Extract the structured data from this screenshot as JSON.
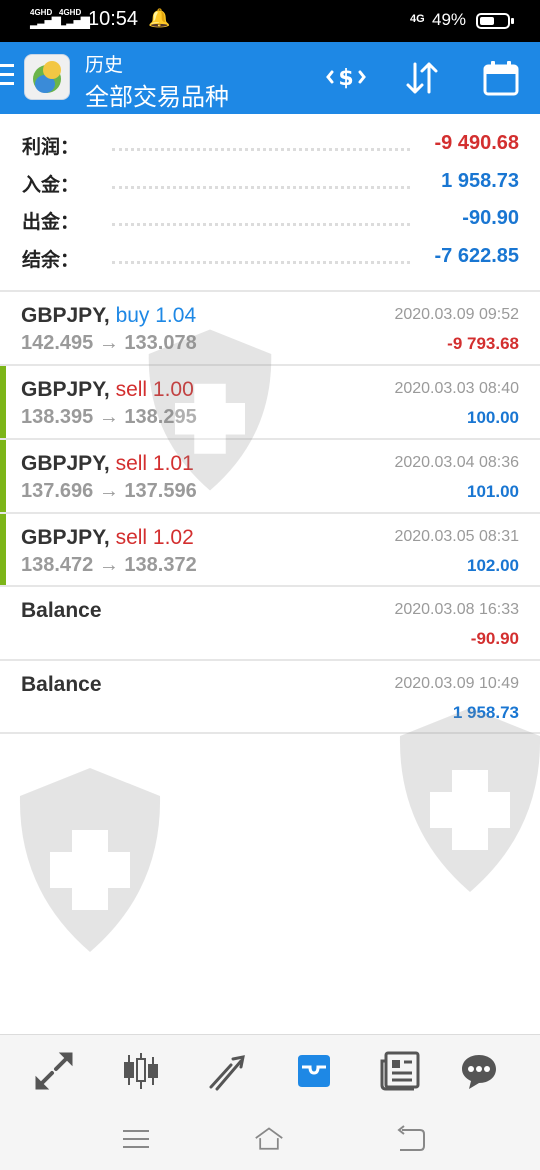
{
  "status_bar": {
    "sig1": "4GHD",
    "sig2": "4GHD",
    "time": "10:54",
    "network": "4G",
    "battery_pct": "49%",
    "battery_level": 0.49
  },
  "header": {
    "subtitle": "历史",
    "title": "全部交易品种",
    "icons": [
      "menu-icon",
      "metatrader-logo",
      "currency-exchange-icon",
      "sort-icon",
      "calendar-icon"
    ]
  },
  "summary": [
    {
      "label": "利润：",
      "value": "-9 490.68",
      "color": "#d32f2f"
    },
    {
      "label": "入金：",
      "value": "1 958.73",
      "color": "#1976d2"
    },
    {
      "label": "出金：",
      "value": "-90.90",
      "color": "#1976d2"
    },
    {
      "label": "结余：",
      "value": "-7 622.85",
      "color": "#1976d2"
    }
  ],
  "trades": [
    {
      "symbol": "GBPJPY,",
      "side": "buy 1.04",
      "side_color": "#1e88e5",
      "prices": "142.495 → 133.078",
      "date": "2020.03.09 09:52",
      "amount": "-9 793.68",
      "amount_color": "#d32f2f",
      "marker": false
    },
    {
      "symbol": "GBPJPY,",
      "side": "sell 1.00",
      "side_color": "#d32f2f",
      "prices": "138.395 → 138.295",
      "date": "2020.03.03 08:40",
      "amount": "100.00",
      "amount_color": "#1976d2",
      "marker": true
    },
    {
      "symbol": "GBPJPY,",
      "side": "sell 1.01",
      "side_color": "#d32f2f",
      "prices": "137.696 → 137.596",
      "date": "2020.03.04 08:36",
      "amount": "101.00",
      "amount_color": "#1976d2",
      "marker": true
    },
    {
      "symbol": "GBPJPY,",
      "side": "sell 1.02",
      "side_color": "#d32f2f",
      "prices": "138.472 → 138.372",
      "date": "2020.03.05 08:31",
      "amount": "102.00",
      "amount_color": "#1976d2",
      "marker": true
    },
    {
      "symbol": "Balance",
      "side": "",
      "side_color": "#333333",
      "prices": "",
      "date": "2020.03.08 16:33",
      "amount": "-90.90",
      "amount_color": "#d32f2f",
      "marker": false
    },
    {
      "symbol": "Balance",
      "side": "",
      "side_color": "#333333",
      "prices": "",
      "date": "2020.03.09 10:49",
      "amount": "1 958.73",
      "amount_color": "#1976d2",
      "marker": false
    }
  ],
  "toolbar": {
    "items": [
      "quotes-icon",
      "chart-icon",
      "trade-icon",
      "history-icon",
      "news-icon",
      "chat-icon"
    ],
    "active": "history-icon",
    "accent": "#1e88e5"
  },
  "system_nav": [
    "recents-icon",
    "home-icon",
    "back-icon"
  ]
}
